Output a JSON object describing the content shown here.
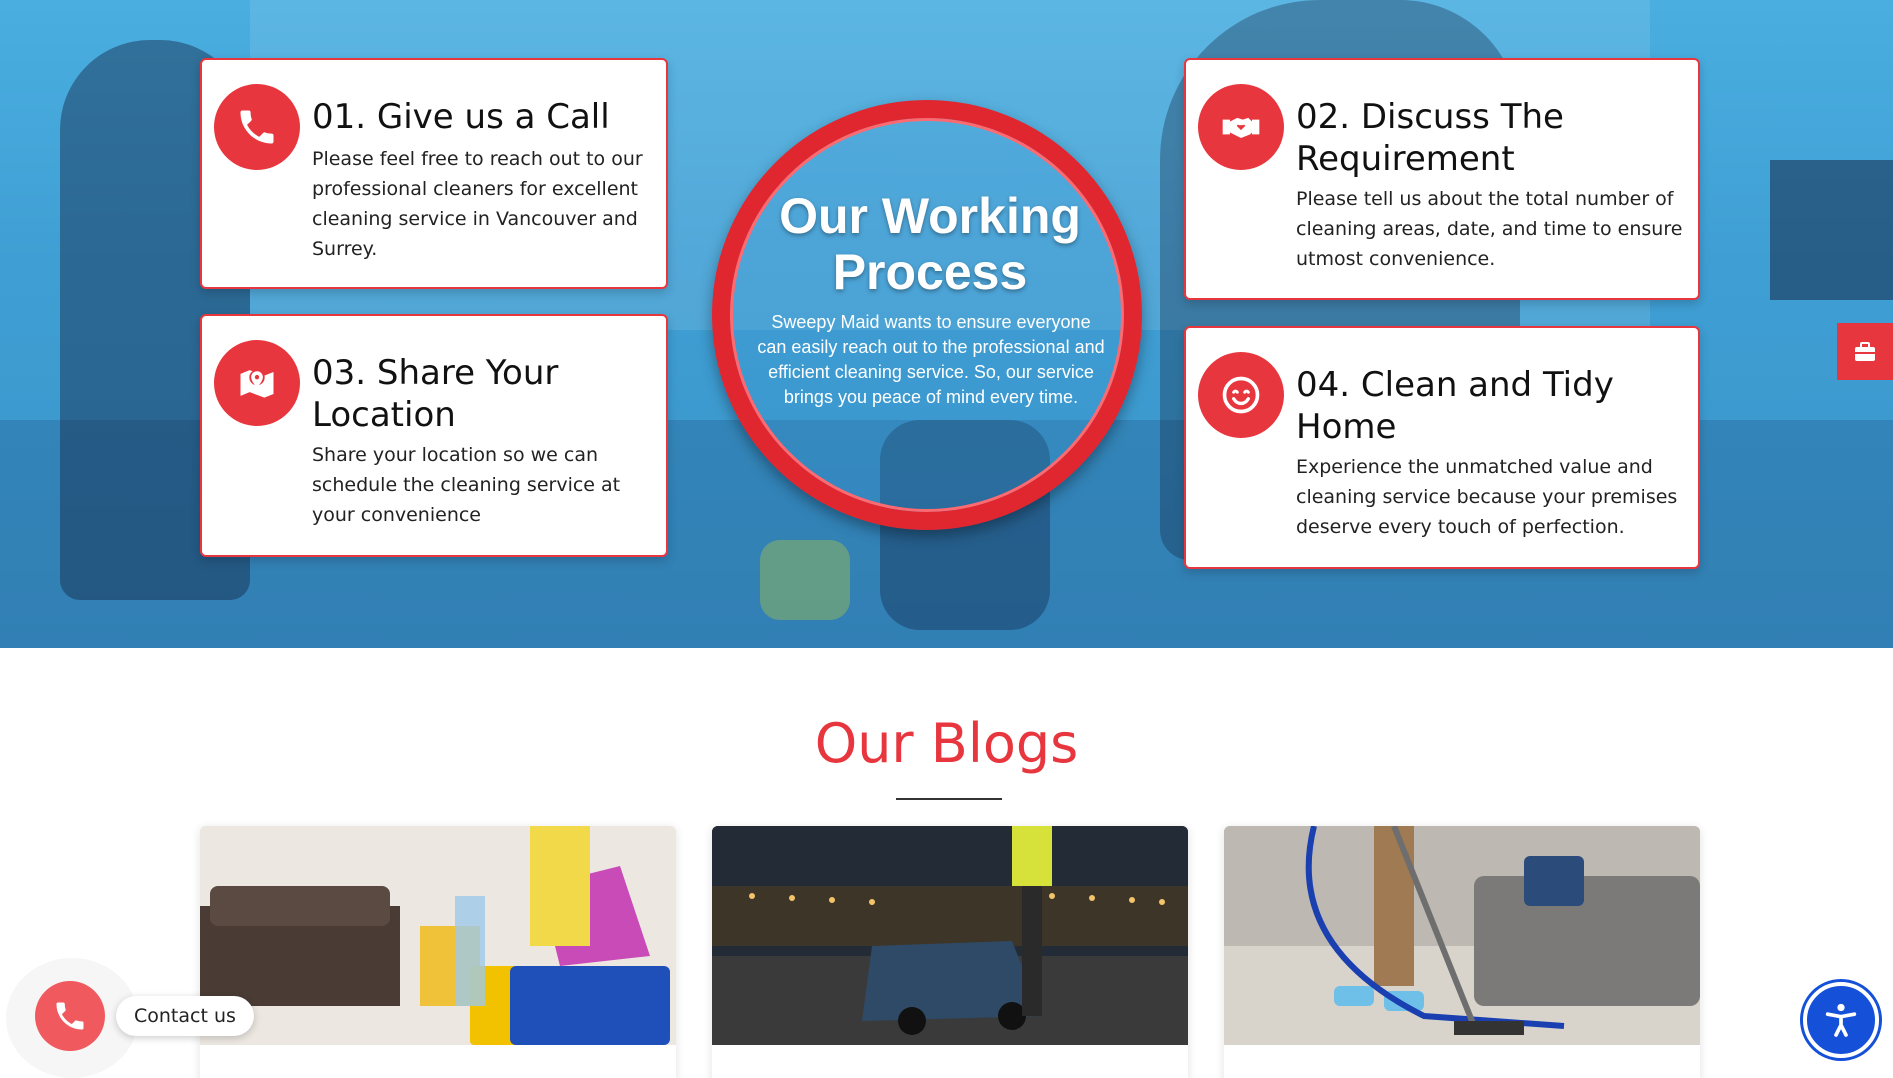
{
  "process": {
    "heading": "Our Working Process",
    "intro": "Sweepy Maid wants to ensure everyone can easily reach out to the professional and efficient cleaning service. So, our service brings you peace of mind every time.",
    "steps": [
      {
        "title": "01. Give us a Call",
        "text": "Please feel free to reach out to our professional cleaners for excellent cleaning service in Vancouver and Surrey.",
        "icon": "phone-icon"
      },
      {
        "title": "02. Discuss The Requirement",
        "text": "Please tell us about the total number of cleaning areas, date, and time to ensure utmost convenience.",
        "icon": "handshake-icon"
      },
      {
        "title": "03. Share Your Location",
        "text": "Share your location so we can schedule the cleaning service at your convenience",
        "icon": "map-pin-icon"
      },
      {
        "title": "04. Clean and Tidy Home",
        "text": "Experience the unmatched value and cleaning service because your premises deserve every touch of perfection.",
        "icon": "smile-icon"
      }
    ]
  },
  "blogs": {
    "heading": "Our Blogs"
  },
  "widgets": {
    "contact_label": "Contact us"
  },
  "colors": {
    "accent": "#e8363e",
    "accessibility": "#1450d8"
  }
}
